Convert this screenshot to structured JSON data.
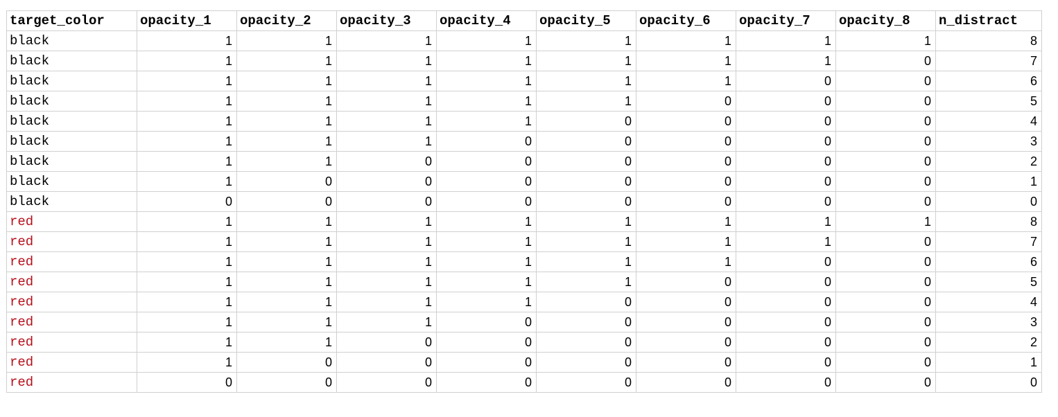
{
  "colors": {
    "black": "#000000",
    "red": "#b5101b",
    "grid": "#d0d0d0"
  },
  "table": {
    "columns": [
      "target_color",
      "opacity_1",
      "opacity_2",
      "opacity_3",
      "opacity_4",
      "opacity_5",
      "opacity_6",
      "opacity_7",
      "opacity_8",
      "n_distract"
    ],
    "rows": [
      [
        "black",
        "1",
        "1",
        "1",
        "1",
        "1",
        "1",
        "1",
        "1",
        "8"
      ],
      [
        "black",
        "1",
        "1",
        "1",
        "1",
        "1",
        "1",
        "1",
        "0",
        "7"
      ],
      [
        "black",
        "1",
        "1",
        "1",
        "1",
        "1",
        "1",
        "0",
        "0",
        "6"
      ],
      [
        "black",
        "1",
        "1",
        "1",
        "1",
        "1",
        "0",
        "0",
        "0",
        "5"
      ],
      [
        "black",
        "1",
        "1",
        "1",
        "1",
        "0",
        "0",
        "0",
        "0",
        "4"
      ],
      [
        "black",
        "1",
        "1",
        "1",
        "0",
        "0",
        "0",
        "0",
        "0",
        "3"
      ],
      [
        "black",
        "1",
        "1",
        "0",
        "0",
        "0",
        "0",
        "0",
        "0",
        "2"
      ],
      [
        "black",
        "1",
        "0",
        "0",
        "0",
        "0",
        "0",
        "0",
        "0",
        "1"
      ],
      [
        "black",
        "0",
        "0",
        "0",
        "0",
        "0",
        "0",
        "0",
        "0",
        "0"
      ],
      [
        "red",
        "1",
        "1",
        "1",
        "1",
        "1",
        "1",
        "1",
        "1",
        "8"
      ],
      [
        "red",
        "1",
        "1",
        "1",
        "1",
        "1",
        "1",
        "1",
        "0",
        "7"
      ],
      [
        "red",
        "1",
        "1",
        "1",
        "1",
        "1",
        "1",
        "0",
        "0",
        "6"
      ],
      [
        "red",
        "1",
        "1",
        "1",
        "1",
        "1",
        "0",
        "0",
        "0",
        "5"
      ],
      [
        "red",
        "1",
        "1",
        "1",
        "1",
        "0",
        "0",
        "0",
        "0",
        "4"
      ],
      [
        "red",
        "1",
        "1",
        "1",
        "0",
        "0",
        "0",
        "0",
        "0",
        "3"
      ],
      [
        "red",
        "1",
        "1",
        "0",
        "0",
        "0",
        "0",
        "0",
        "0",
        "2"
      ],
      [
        "red",
        "1",
        "0",
        "0",
        "0",
        "0",
        "0",
        "0",
        "0",
        "1"
      ],
      [
        "red",
        "0",
        "0",
        "0",
        "0",
        "0",
        "0",
        "0",
        "0",
        "0"
      ]
    ]
  }
}
